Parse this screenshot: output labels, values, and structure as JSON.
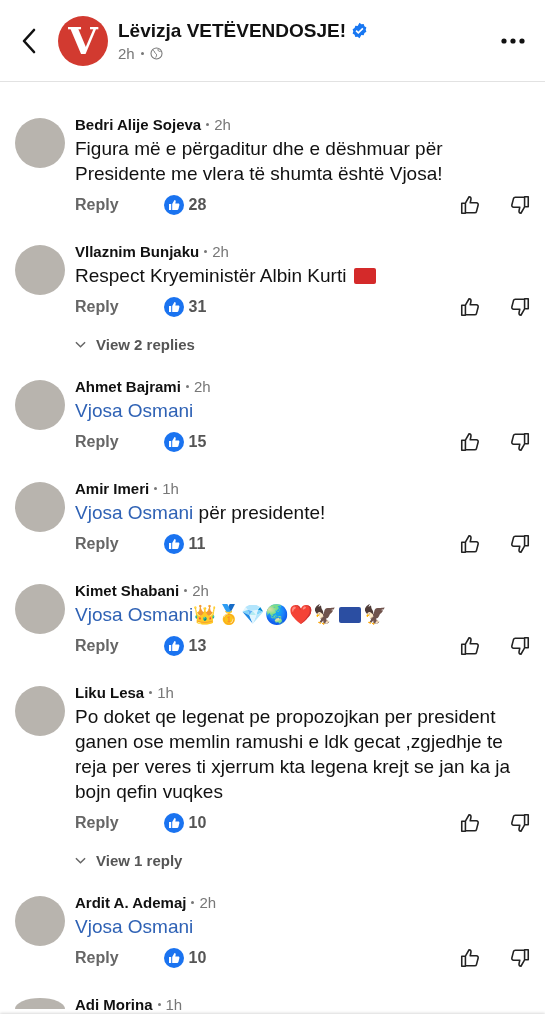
{
  "header": {
    "page_name": "Lëvizja VETËVENDOSJE!",
    "verified": true,
    "logo_letter": "V",
    "time": "2h"
  },
  "comments": [
    {
      "author": "Bedri Alije Sojeva",
      "time": "2h",
      "parts": [
        {
          "kind": "text",
          "text": "Figura më e përgaditur dhe e dëshmuar për Presidente me vlera të shumta është Vjosa!"
        }
      ],
      "reply": "Reply",
      "likes": "28"
    },
    {
      "author": "Vllaznim Bunjaku",
      "time": "2h",
      "parts": [
        {
          "kind": "text",
          "text": "Respect Kryeministër Albin Kurti "
        },
        {
          "kind": "flag",
          "color": "#d42a2a"
        }
      ],
      "reply": "Reply",
      "likes": "31",
      "view_replies": "View 2 replies"
    },
    {
      "author": "Ahmet Bajrami",
      "time": "2h",
      "parts": [
        {
          "kind": "mention",
          "text": "Vjosa Osmani"
        }
      ],
      "reply": "Reply",
      "likes": "15"
    },
    {
      "author": "Amir Imeri",
      "time": "1h",
      "parts": [
        {
          "kind": "mention",
          "text": "Vjosa Osmani"
        },
        {
          "kind": "text",
          "text": " për presidente!"
        }
      ],
      "reply": "Reply",
      "likes": "11"
    },
    {
      "author": "Kimet Shabani",
      "time": "2h",
      "parts": [
        {
          "kind": "mention",
          "text": "Vjosa Osmani"
        },
        {
          "kind": "text",
          "text": "👑🥇💎🌏❤️🦅"
        },
        {
          "kind": "flag",
          "color": "#2b4ea2"
        },
        {
          "kind": "text",
          "text": "🦅"
        }
      ],
      "reply": "Reply",
      "likes": "13"
    },
    {
      "author": "Liku Lesa",
      "time": "1h",
      "parts": [
        {
          "kind": "text",
          "text": "Po doket qe legenat pe propozojkan per president ganen ose memlin ramushi e ldk gecat ,zgjedhje te reja per veres ti xjerrum kta legena krejt se jan ka ja bojn qefin vuqkes"
        }
      ],
      "reply": "Reply",
      "likes": "10",
      "view_replies": "View 1 reply"
    },
    {
      "author": "Ardit A. Ademaj",
      "time": "2h",
      "parts": [
        {
          "kind": "mention",
          "text": "Vjosa Osmani"
        }
      ],
      "reply": "Reply",
      "likes": "10"
    }
  ],
  "partial_comment": {
    "author": "Adi Morina",
    "time": "1h"
  }
}
